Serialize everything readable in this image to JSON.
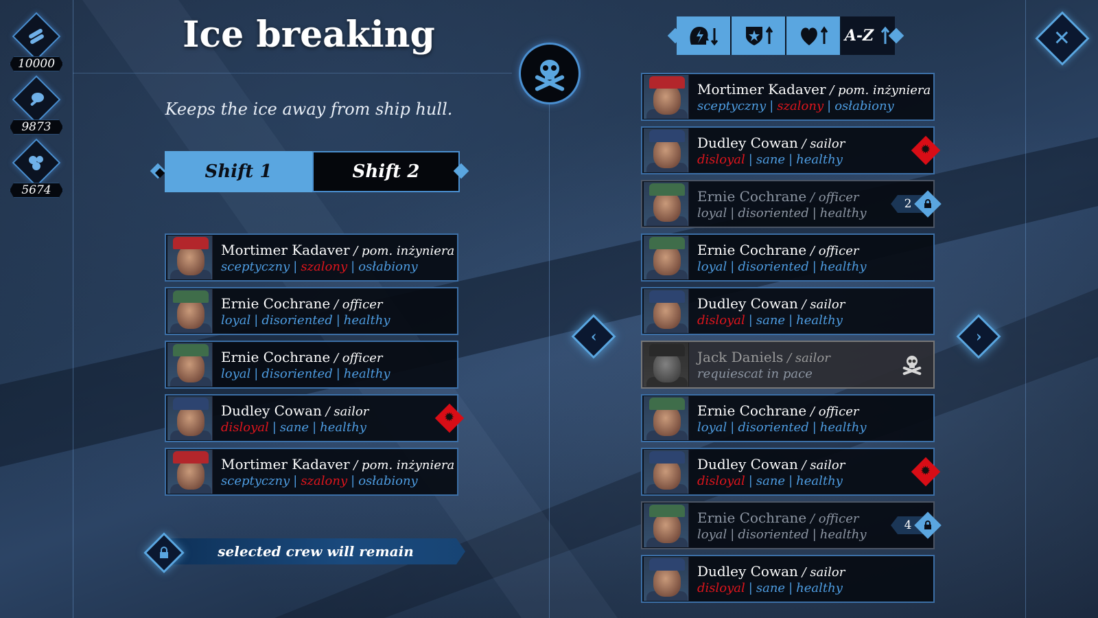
{
  "resources": [
    {
      "icon": "wood-logs-icon",
      "value": "10000"
    },
    {
      "icon": "meat-icon",
      "value": "9873"
    },
    {
      "icon": "coal-icon",
      "value": "5674"
    }
  ],
  "title": "Ice breaking",
  "description": "Keeps the ice away from ship hull.",
  "shifts": [
    {
      "label": "Shift 1",
      "active": true
    },
    {
      "label": "Shift 2",
      "active": false
    }
  ],
  "sort": {
    "az_label": "A-Z"
  },
  "assigned_crew": [
    {
      "name": "Mortimer Kadaver",
      "role": "pom. inżyniera",
      "hat": "#b3262b",
      "traits": [
        {
          "text": "sceptyczny",
          "color": "blue"
        },
        {
          "text": "szalony",
          "color": "red"
        },
        {
          "text": "osłabiony",
          "color": "blue"
        }
      ]
    },
    {
      "name": "Ernie Cochrane",
      "role": "officer",
      "hat": "#3f6d4a",
      "traits": [
        {
          "text": "loyal",
          "color": "blue"
        },
        {
          "text": "disoriented",
          "color": "blue"
        },
        {
          "text": "healthy",
          "color": "blue"
        }
      ]
    },
    {
      "name": "Ernie Cochrane",
      "role": "officer",
      "hat": "#3f6d4a",
      "traits": [
        {
          "text": "loyal",
          "color": "blue"
        },
        {
          "text": "disoriented",
          "color": "blue"
        },
        {
          "text": "healthy",
          "color": "blue"
        }
      ]
    },
    {
      "name": "Dudley Cowan",
      "role": "sailor",
      "hat": "#2d4470",
      "badge": "mutiny",
      "traits": [
        {
          "text": "disloyal",
          "color": "red"
        },
        {
          "text": "sane",
          "color": "blue"
        },
        {
          "text": "healthy",
          "color": "blue"
        }
      ]
    },
    {
      "name": "Mortimer Kadaver",
      "role": "pom. inżyniera",
      "hat": "#b3262b",
      "traits": [
        {
          "text": "sceptyczny",
          "color": "blue"
        },
        {
          "text": "szalony",
          "color": "red"
        },
        {
          "text": "osłabiony",
          "color": "blue"
        }
      ]
    }
  ],
  "remain_label": "selected crew will remain",
  "roster": [
    {
      "name": "Mortimer Kadaver",
      "role": "pom. inżyniera",
      "hat": "#b3262b",
      "traits": [
        {
          "text": "sceptyczny",
          "color": "blue"
        },
        {
          "text": "szalony",
          "color": "red"
        },
        {
          "text": "osłabiony",
          "color": "blue"
        }
      ]
    },
    {
      "name": "Dudley Cowan",
      "role": "sailor",
      "hat": "#2d4470",
      "badge": "mutiny",
      "traits": [
        {
          "text": "disloyal",
          "color": "red"
        },
        {
          "text": "sane",
          "color": "blue"
        },
        {
          "text": "healthy",
          "color": "blue"
        }
      ]
    },
    {
      "name": "Ernie Cochrane",
      "role": "officer",
      "hat": "#3f6d4a",
      "faded": true,
      "lock": "2",
      "traits": [
        {
          "text": "loyal",
          "color": "grey"
        },
        {
          "text": "disoriented",
          "color": "grey"
        },
        {
          "text": "healthy",
          "color": "grey"
        }
      ]
    },
    {
      "name": "Ernie Cochrane",
      "role": "officer",
      "hat": "#3f6d4a",
      "traits": [
        {
          "text": "loyal",
          "color": "blue"
        },
        {
          "text": "disoriented",
          "color": "blue"
        },
        {
          "text": "healthy",
          "color": "blue"
        }
      ]
    },
    {
      "name": "Dudley Cowan",
      "role": "sailor",
      "hat": "#2d4470",
      "traits": [
        {
          "text": "disloyal",
          "color": "red"
        },
        {
          "text": "sane",
          "color": "blue"
        },
        {
          "text": "healthy",
          "color": "blue"
        }
      ]
    },
    {
      "name": "Jack Daniels",
      "role": "sailor",
      "hat": "#333",
      "dead": true,
      "traits": [
        {
          "text": "requiescat in pace",
          "color": "grey"
        }
      ]
    },
    {
      "name": "Ernie Cochrane",
      "role": "officer",
      "hat": "#3f6d4a",
      "traits": [
        {
          "text": "loyal",
          "color": "blue"
        },
        {
          "text": "disoriented",
          "color": "blue"
        },
        {
          "text": "healthy",
          "color": "blue"
        }
      ]
    },
    {
      "name": "Dudley Cowan",
      "role": "sailor",
      "hat": "#2d4470",
      "badge": "mutiny",
      "traits": [
        {
          "text": "disloyal",
          "color": "red"
        },
        {
          "text": "sane",
          "color": "blue"
        },
        {
          "text": "healthy",
          "color": "blue"
        }
      ]
    },
    {
      "name": "Ernie Cochrane",
      "role": "officer",
      "hat": "#3f6d4a",
      "faded": true,
      "lock": "4",
      "traits": [
        {
          "text": "loyal",
          "color": "grey"
        },
        {
          "text": "disoriented",
          "color": "grey"
        },
        {
          "text": "healthy",
          "color": "grey"
        }
      ]
    },
    {
      "name": "Dudley Cowan",
      "role": "sailor",
      "hat": "#2d4470",
      "traits": [
        {
          "text": "disloyal",
          "color": "red"
        },
        {
          "text": "sane",
          "color": "blue"
        },
        {
          "text": "healthy",
          "color": "blue"
        }
      ]
    }
  ],
  "colors": {
    "accent": "#5aa6e0",
    "trait_blue": "#4e9de2",
    "trait_red": "#e0151c",
    "mutiny_badge": "#d80d16"
  }
}
